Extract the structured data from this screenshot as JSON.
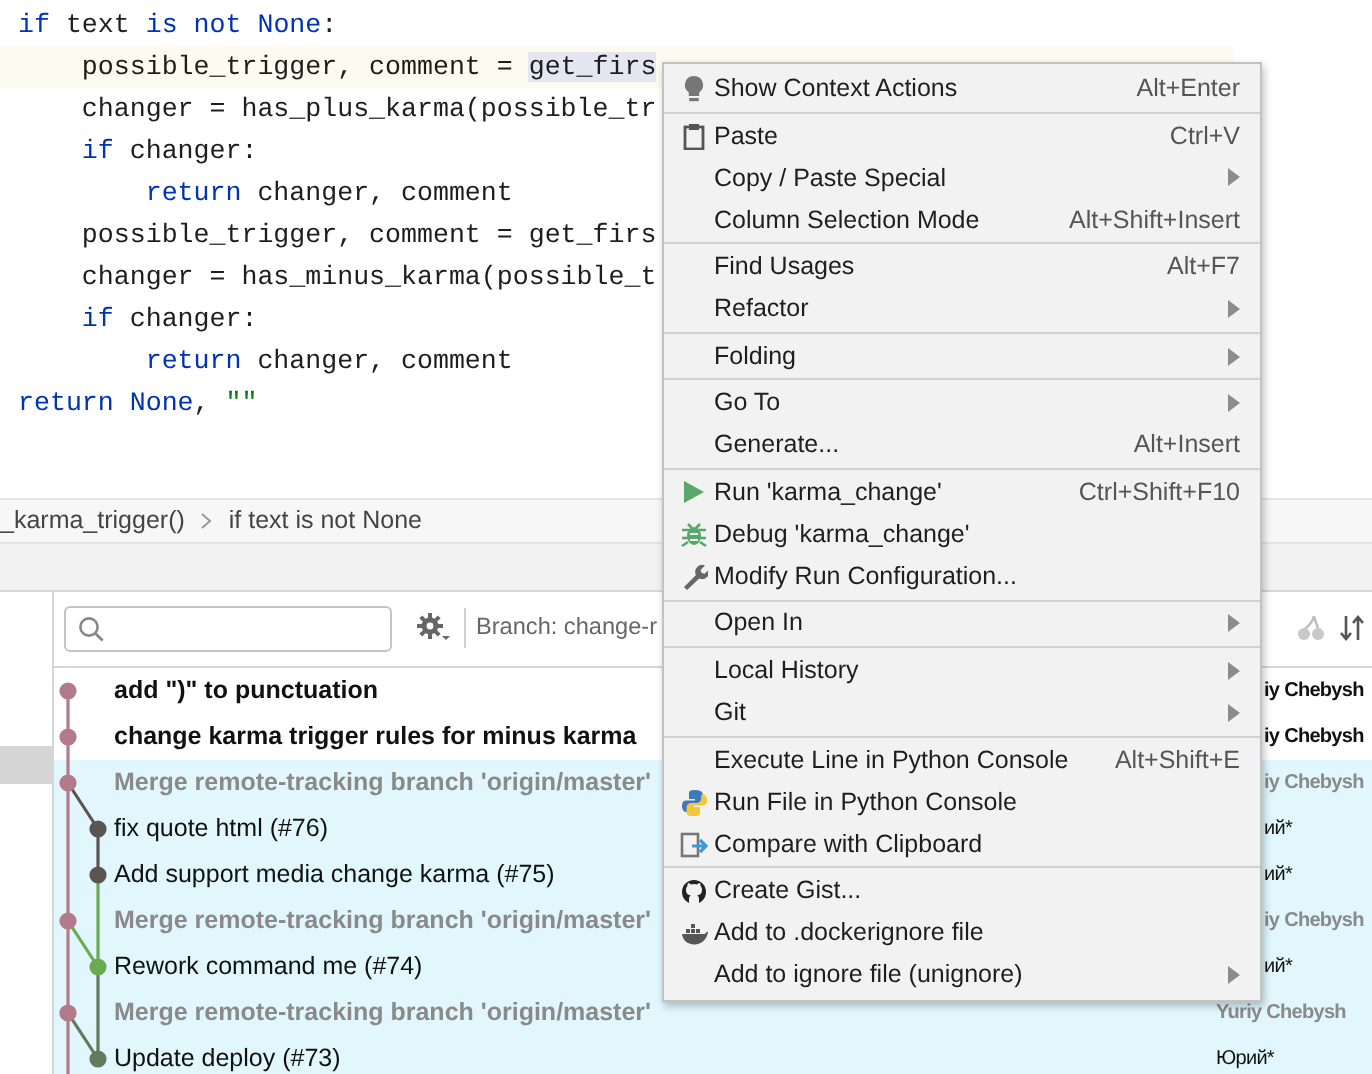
{
  "editor": {
    "lines": [
      {
        "current": false,
        "tokens": [
          {
            "kind": "keyword",
            "text": "if"
          },
          {
            "kind": "plain",
            "text": " text "
          },
          {
            "kind": "keyword",
            "text": "is not None"
          },
          {
            "kind": "plain",
            "text": ":"
          }
        ]
      },
      {
        "current": true,
        "tokens": [
          {
            "kind": "plain",
            "text": "    possible_trigger, comment = "
          },
          {
            "kind": "selection",
            "text": "get_firs"
          }
        ]
      },
      {
        "current": false,
        "tokens": [
          {
            "kind": "plain",
            "text": "    changer = has_plus_karma(possible_tr"
          }
        ]
      },
      {
        "current": false,
        "tokens": [
          {
            "kind": "keyword",
            "text": "    if"
          },
          {
            "kind": "plain",
            "text": " changer:"
          }
        ]
      },
      {
        "current": false,
        "tokens": [
          {
            "kind": "keyword",
            "text": "        return"
          },
          {
            "kind": "plain",
            "text": " changer, comment"
          }
        ]
      },
      {
        "current": false,
        "tokens": [
          {
            "kind": "plain",
            "text": "    possible_trigger, comment = get_firs"
          }
        ]
      },
      {
        "current": false,
        "tokens": [
          {
            "kind": "plain",
            "text": "    changer = has_minus_karma(possible_t"
          }
        ]
      },
      {
        "current": false,
        "tokens": [
          {
            "kind": "keyword",
            "text": "    if"
          },
          {
            "kind": "plain",
            "text": " changer:"
          }
        ]
      },
      {
        "current": false,
        "tokens": [
          {
            "kind": "keyword",
            "text": "        return"
          },
          {
            "kind": "plain",
            "text": " changer, comment"
          }
        ]
      },
      {
        "current": false,
        "tokens": [
          {
            "kind": "keyword",
            "text": "return None"
          },
          {
            "kind": "plain",
            "text": ", "
          },
          {
            "kind": "string",
            "text": "\"\""
          }
        ]
      }
    ]
  },
  "breadcrumbs": [
    "_karma_trigger()",
    "if text is not None"
  ],
  "log_toolbar": {
    "branch_filter": "Branch: change-r"
  },
  "commits": [
    {
      "message": "add \")\" to punctuation",
      "kind": "unpushed",
      "author": "iy Chebysh",
      "selected": false,
      "color": "#b37a8b"
    },
    {
      "message": "change karma trigger rules for minus karma",
      "kind": "unpushed",
      "author": "iy Chebysh",
      "selected": false,
      "color": "#b37a8b"
    },
    {
      "message": "Merge remote-tracking branch 'origin/master'",
      "kind": "merge",
      "author": "iy Chebysh",
      "selected": true,
      "color": "#b37a8b"
    },
    {
      "message": "fix quote html (#76)",
      "kind": "normal",
      "author": "ий*",
      "selected": true,
      "color": "#5b5552"
    },
    {
      "message": "Add support media change karma (#75)",
      "kind": "normal",
      "author": "ий*",
      "selected": true,
      "color": "#5b5552"
    },
    {
      "message": "Merge remote-tracking branch 'origin/master'",
      "kind": "merge",
      "author": "iy Chebysh",
      "selected": true,
      "color": "#b37a8b"
    },
    {
      "message": "Rework command me (#74)",
      "kind": "normal",
      "author": "ий*",
      "selected": true,
      "color": "#6aab52"
    },
    {
      "message": "Merge remote-tracking branch 'origin/master'",
      "kind": "merge",
      "author": "Yuriy Chebysh",
      "selected": true,
      "color": "#b37a8b"
    },
    {
      "message": "Update deploy (#73)",
      "kind": "normal",
      "author": "Юрий*",
      "selected": true,
      "color": "#5f7d5c"
    }
  ],
  "context_menu": {
    "groups": [
      [
        {
          "kind": "bulb",
          "label": "Show Context Actions",
          "shortcut": "Alt+Enter",
          "submenu": false
        }
      ],
      [
        {
          "kind": "paste",
          "label": "Paste",
          "shortcut": "Ctrl+V",
          "submenu": false
        },
        {
          "label": "Copy / Paste Special",
          "submenu": true
        },
        {
          "label": "Column Selection Mode",
          "shortcut": "Alt+Shift+Insert",
          "submenu": false
        }
      ],
      [
        {
          "label": "Find Usages",
          "shortcut": "Alt+F7",
          "submenu": false
        },
        {
          "label": "Refactor",
          "submenu": true
        }
      ],
      [
        {
          "label": "Folding",
          "submenu": true
        }
      ],
      [
        {
          "label": "Go To",
          "submenu": true
        },
        {
          "label": "Generate...",
          "shortcut": "Alt+Insert",
          "submenu": false
        }
      ],
      [
        {
          "kind": "run",
          "label": "Run 'karma_change'",
          "shortcut": "Ctrl+Shift+F10",
          "submenu": false
        },
        {
          "kind": "debug",
          "label": "Debug 'karma_change'",
          "submenu": false
        },
        {
          "kind": "wrench",
          "label": "Modify Run Configuration...",
          "submenu": false
        }
      ],
      [
        {
          "label": "Open In",
          "submenu": true
        }
      ],
      [
        {
          "label": "Local History",
          "submenu": true
        },
        {
          "label": "Git",
          "submenu": true
        }
      ],
      [
        {
          "label": "Execute Line in Python Console",
          "shortcut": "Alt+Shift+E",
          "submenu": false
        },
        {
          "kind": "python",
          "label": "Run File in Python Console",
          "submenu": false
        },
        {
          "kind": "compare",
          "label": "Compare with Clipboard",
          "submenu": false
        }
      ],
      [
        {
          "kind": "github",
          "label": "Create Gist...",
          "submenu": false
        },
        {
          "kind": "docker",
          "label": "Add to .dockerignore file",
          "submenu": false
        },
        {
          "label": "Add to ignore file (unignore)",
          "submenu": true
        }
      ]
    ]
  }
}
